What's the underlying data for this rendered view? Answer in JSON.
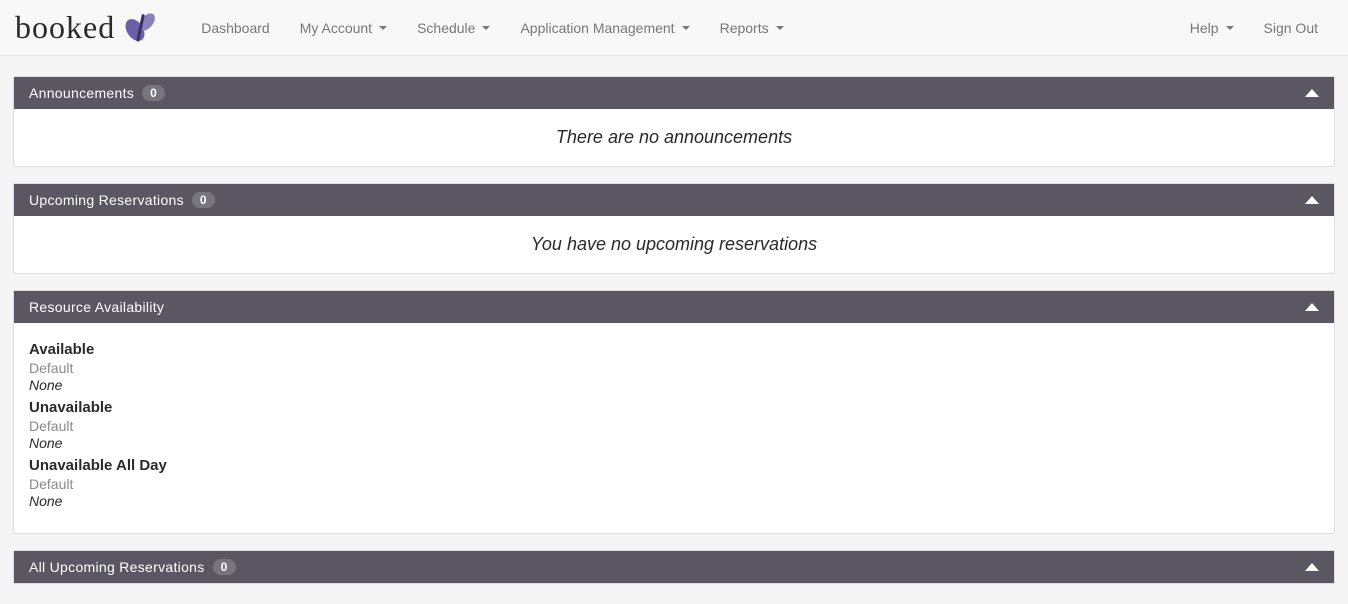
{
  "brand": {
    "text": "booked"
  },
  "nav": {
    "left": [
      {
        "label": "Dashboard",
        "dropdown": false
      },
      {
        "label": "My Account",
        "dropdown": true
      },
      {
        "label": "Schedule",
        "dropdown": true
      },
      {
        "label": "Application Management",
        "dropdown": true
      },
      {
        "label": "Reports",
        "dropdown": true
      }
    ],
    "right": [
      {
        "label": "Help",
        "dropdown": true
      },
      {
        "label": "Sign Out",
        "dropdown": false
      }
    ]
  },
  "panels": {
    "announcements": {
      "title": "Announcements",
      "count": "0",
      "empty": "There are no announcements"
    },
    "upcoming": {
      "title": "Upcoming Reservations",
      "count": "0",
      "empty": "You have no upcoming reservations"
    },
    "resource": {
      "title": "Resource Availability",
      "groups": [
        {
          "heading": "Available",
          "sub": "Default",
          "none": "None"
        },
        {
          "heading": "Unavailable",
          "sub": "Default",
          "none": "None"
        },
        {
          "heading": "Unavailable All Day",
          "sub": "Default",
          "none": "None"
        }
      ]
    },
    "all_upcoming": {
      "title": "All Upcoming Reservations",
      "count": "0"
    }
  }
}
